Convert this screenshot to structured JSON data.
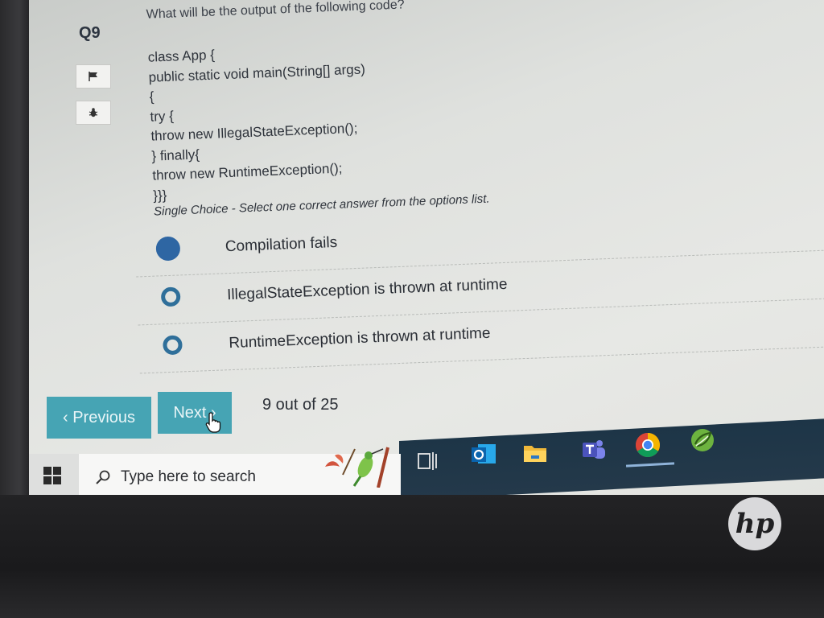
{
  "question": {
    "number": "Q9",
    "text": "What will be the output of the following code?",
    "code_lines": [
      "class App {",
      "public static void main(String[] args)",
      "{",
      "try {",
      "throw new IllegalStateException();",
      "} finally{",
      "throw new RuntimeException();",
      "}}}"
    ],
    "instruction": "Single Choice - Select one correct answer from the options list."
  },
  "options": [
    {
      "label": "Compilation fails",
      "selected": true
    },
    {
      "label": "IllegalStateException is thrown at runtime",
      "selected": false
    },
    {
      "label": "RuntimeException is thrown at runtime",
      "selected": false
    }
  ],
  "nav": {
    "previous_label": "‹ Previous",
    "next_label": "Next ›",
    "progress": "9 out of 25"
  },
  "taskbar": {
    "search_placeholder": "Type here to search",
    "icons": [
      "windows-start-icon",
      "search-icon",
      "task-view-icon",
      "outlook-icon",
      "file-explorer-icon",
      "teams-icon",
      "chrome-icon",
      "spring-tool-icon"
    ]
  },
  "hardware": {
    "logo_text": "hp"
  },
  "colors": {
    "accent": "#46a4b4",
    "radio": "#2e66a3",
    "taskbar_dark": "#1d3547"
  }
}
